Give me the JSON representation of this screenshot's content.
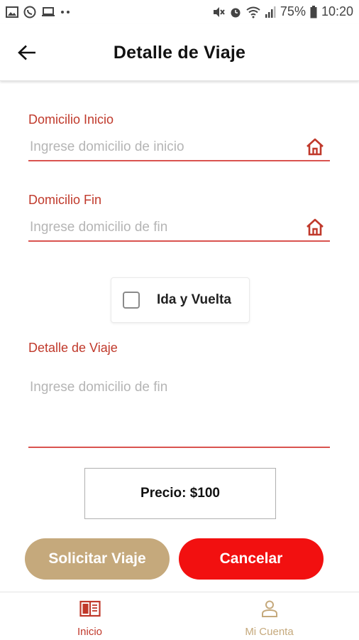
{
  "status_bar": {
    "battery": "75%",
    "time": "10:20",
    "left_icons": [
      "image-icon",
      "whatsapp-icon",
      "laptop-icon",
      "more-dots-icon"
    ],
    "right_icons": [
      "mute-icon",
      "alarm-icon",
      "wifi-icon",
      "signal-icon",
      "battery-icon"
    ]
  },
  "header": {
    "title": "Detalle de Viaje",
    "back_icon": "arrow-left-icon"
  },
  "form": {
    "start": {
      "label": "Domicilio Inicio",
      "placeholder": "Ingrese domicilio de inicio",
      "value": "",
      "icon": "home-icon"
    },
    "end": {
      "label": "Domicilio Fin",
      "placeholder": "Ingrese domicilio de fin",
      "value": "",
      "icon": "home-icon"
    },
    "round_trip": {
      "label": "Ida y Vuelta",
      "checked": false
    },
    "detail": {
      "label": "Detalle de Viaje",
      "placeholder": "Ingrese domicilio de fin",
      "value": ""
    }
  },
  "price": {
    "text": "Precio: $100"
  },
  "buttons": {
    "request": "Solicitar Viaje",
    "cancel": "Cancelar"
  },
  "bottom_nav": {
    "items": [
      {
        "label": "Inicio",
        "icon": "book-icon",
        "active": true
      },
      {
        "label": "Mi Cuenta",
        "icon": "person-icon",
        "active": false
      }
    ]
  },
  "colors": {
    "accent_red": "#c0392b",
    "cancel_red": "#f21010",
    "gold": "#c5a97c"
  }
}
